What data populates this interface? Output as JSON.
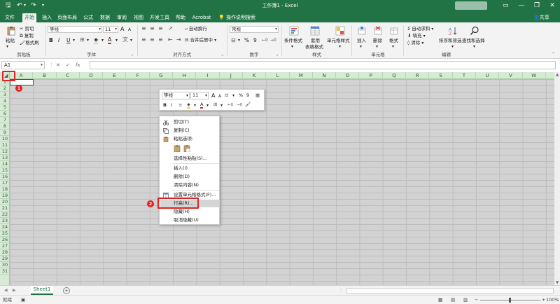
{
  "window": {
    "doc_title": "工作簿1 - Excel",
    "minimize": "—",
    "restore": "❐",
    "close": "✕"
  },
  "tabs": [
    "文件",
    "开始",
    "插入",
    "页面布局",
    "公式",
    "数据",
    "审阅",
    "视图",
    "开发工具",
    "帮助",
    "Acrobat"
  ],
  "active_tab": "开始",
  "search_label": "操作说明搜索",
  "share_label": "共享",
  "ribbon": {
    "clipboard": {
      "paste": "粘贴",
      "cut": "剪切",
      "copy": "复制",
      "format_painter": "格式刷",
      "label": "剪贴板"
    },
    "font": {
      "name": "等线",
      "size": "11",
      "grow": "A",
      "shrink": "A",
      "bold": "B",
      "italic": "I",
      "underline": "U",
      "label": "字体"
    },
    "alignment": {
      "wrap": "自动换行",
      "merge": "合并后居中",
      "label": "对齐方式"
    },
    "number": {
      "format": "常规",
      "percent": "%",
      "comma": "9",
      "label": "数字"
    },
    "styles": {
      "conditional": "条件格式",
      "table1": "套用",
      "table2": "表格格式",
      "cell_styles": "单元格样式",
      "label": "样式"
    },
    "cells": {
      "insert": "插入",
      "delete": "删除",
      "format": "格式",
      "label": "单元格"
    },
    "editing": {
      "autosum": "自动求和",
      "fill": "填充",
      "clear": "清除",
      "sort": "排序和筛选",
      "find": "查找和选择",
      "label": "编辑"
    }
  },
  "formula_bar": {
    "name_box": "A1",
    "cancel": "✕",
    "enter": "✓",
    "fx": "fx"
  },
  "columns": [
    "A",
    "B",
    "C",
    "D",
    "E",
    "F",
    "G",
    "H",
    "I",
    "J",
    "K",
    "L",
    "M",
    "N",
    "O",
    "P",
    "Q",
    "R",
    "S",
    "T",
    "U",
    "V",
    "W"
  ],
  "rows": [
    "1",
    "2",
    "3",
    "4",
    "5",
    "6",
    "7",
    "8",
    "9",
    "10",
    "11",
    "12",
    "13",
    "14",
    "15",
    "16",
    "17",
    "18",
    "19",
    "20",
    "21",
    "22",
    "23",
    "24",
    "25",
    "26",
    "27",
    "28",
    "29",
    "30",
    "31"
  ],
  "sheet_tab": "Sheet1",
  "add_sheet": "+",
  "status": {
    "ready": "就绪",
    "zoom": "100%",
    "minus": "−",
    "plus": "+"
  },
  "mini_toolbar": {
    "font": "等线",
    "size": "11",
    "bold": "B",
    "italic": "I",
    "percent": "%",
    "comma": "9"
  },
  "context_menu": [
    "剪切(T)",
    "复制(C)",
    "粘贴选项:",
    "",
    "选择性粘贴(S)...",
    "插入(I)",
    "删除(D)",
    "清除内容(N)",
    "设置单元格格式(F)...",
    "行高(R)...",
    "隐藏(H)",
    "取消隐藏(U)"
  ],
  "annotations": {
    "step1": "1",
    "step2": "2"
  },
  "colors": {
    "excel_green": "#217346",
    "highlight_red": "#e02222",
    "header_green": "#d7ead5"
  }
}
